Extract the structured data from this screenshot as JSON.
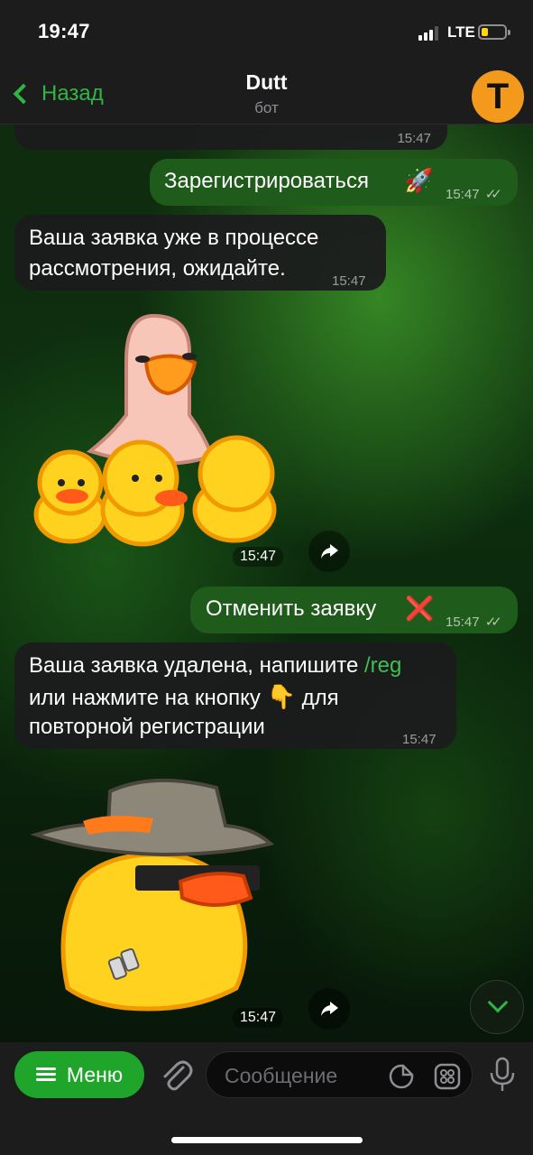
{
  "status_bar": {
    "time": "19:47",
    "network": "LTE"
  },
  "header": {
    "back_label": "Назад",
    "title": "Dutt",
    "subtitle": "бот",
    "avatar_letter": "T"
  },
  "messages": [
    {
      "id": "m0",
      "direction": "in",
      "text": "",
      "time": "15:47"
    },
    {
      "id": "m1",
      "direction": "out",
      "text": "Зарегистрироваться",
      "emoji": "🚀",
      "time": "15:47"
    },
    {
      "id": "m2",
      "direction": "in",
      "text_line1": "Ваша заявка уже в процессе",
      "text_line2": "рассмотрения, ожидайте.",
      "time": "15:47"
    },
    {
      "id": "m3",
      "direction": "in",
      "type": "sticker",
      "sticker": "duck-family",
      "time": "15:47"
    },
    {
      "id": "m4",
      "direction": "out",
      "text": "Отменить заявку",
      "emoji": "❌",
      "time": "15:47"
    },
    {
      "id": "m5",
      "direction": "in",
      "text_line1": "Ваша заявка удалена, напишите",
      "link": "/reg",
      "text_line2a": "или нажмите на кнопку",
      "emoji": "👇",
      "text_line2b": "для",
      "text_line3": "повторной регистрации",
      "time": "15:47"
    },
    {
      "id": "m6",
      "direction": "in",
      "type": "sticker",
      "sticker": "duck-hat-sunglasses",
      "time": "15:47"
    }
  ],
  "bottom_bar": {
    "menu_label": "Меню",
    "input_placeholder": "Сообщение"
  },
  "colors": {
    "accent": "#31b545",
    "outgoing_bubble": "#1f5b1a",
    "incoming_bubble": "#1c1c1e",
    "avatar": "#f39a1c"
  },
  "icons": [
    "chevron-left-icon",
    "signal-icon",
    "battery-icon",
    "share-icon",
    "chevron-down-icon",
    "menu-icon",
    "paperclip-icon",
    "sticker-icon",
    "command-icon",
    "microphone-icon"
  ]
}
